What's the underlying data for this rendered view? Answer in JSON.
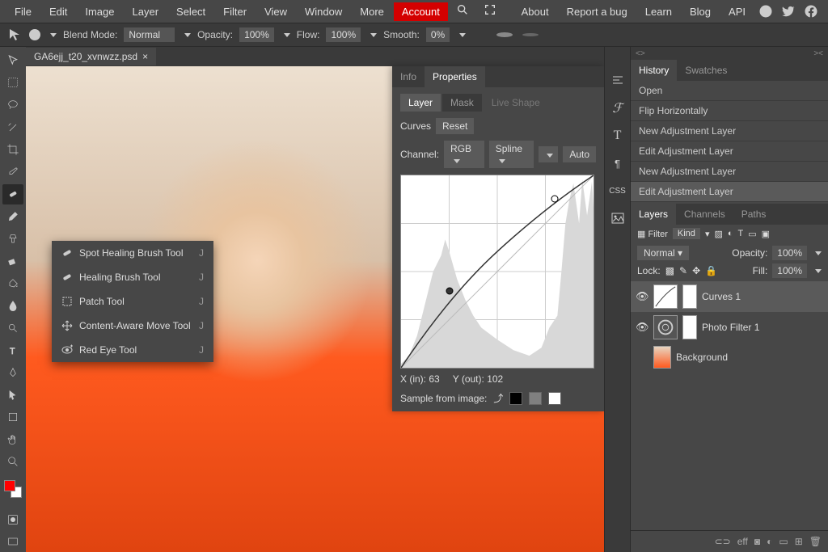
{
  "menubar": {
    "items": [
      "File",
      "Edit",
      "Image",
      "Layer",
      "Select",
      "Filter",
      "View",
      "Window",
      "More"
    ],
    "account": "Account",
    "right": [
      "About",
      "Report a bug",
      "Learn",
      "Blog",
      "API"
    ]
  },
  "optbar": {
    "blend_label": "Blend Mode:",
    "blend_value": "Normal",
    "opacity_label": "Opacity:",
    "opacity_value": "100%",
    "flow_label": "Flow:",
    "flow_value": "100%",
    "smooth_label": "Smooth:",
    "smooth_value": "0%"
  },
  "file_tab": {
    "name": "GA6ejj_t20_xvnwzz.psd",
    "close": "×"
  },
  "context_menu": {
    "items": [
      {
        "icon": "bandage-icon",
        "label": "Spot Healing Brush Tool",
        "key": "J"
      },
      {
        "icon": "bandage-icon",
        "label": "Healing Brush Tool",
        "key": "J"
      },
      {
        "icon": "patch-icon",
        "label": "Patch Tool",
        "key": "J"
      },
      {
        "icon": "move-arrows-icon",
        "label": "Content-Aware Move Tool",
        "key": "J"
      },
      {
        "icon": "eye-plus-icon",
        "label": "Red Eye Tool",
        "key": "J"
      }
    ]
  },
  "props": {
    "tabs": [
      "Info",
      "Properties"
    ],
    "sub_tabs": [
      "Layer",
      "Mask",
      "Live Shape"
    ],
    "title": "Curves",
    "reset": "Reset",
    "channel_label": "Channel:",
    "channel_value": "RGB",
    "spline": "Spline",
    "auto": "Auto",
    "x_label": "X (in):",
    "x_value": "63",
    "y_label": "Y (out):",
    "y_value": "102",
    "sample_label": "Sample from image:",
    "sample_colors": [
      "#000000",
      "#808080",
      "#ffffff"
    ]
  },
  "history": {
    "tabs": [
      "History",
      "Swatches"
    ],
    "items": [
      "Open",
      "Flip Horizontally",
      "New Adjustment Layer",
      "Edit Adjustment Layer",
      "New Adjustment Layer",
      "Edit Adjustment Layer"
    ]
  },
  "layers_panel": {
    "tabs": [
      "Layers",
      "Channels",
      "Paths"
    ],
    "filter_label": "Filter",
    "kind": "Kind",
    "blend": "Normal",
    "opacity_label": "Opacity:",
    "opacity_value": "100%",
    "lock_label": "Lock:",
    "fill_label": "Fill:",
    "fill_value": "100%",
    "layers": [
      {
        "name": "Curves 1",
        "type": "curves"
      },
      {
        "name": "Photo Filter 1",
        "type": "filter"
      },
      {
        "name": "Background",
        "type": "image"
      }
    ]
  },
  "bottom": {
    "link": "⊂⊃",
    "eff": "eff"
  }
}
